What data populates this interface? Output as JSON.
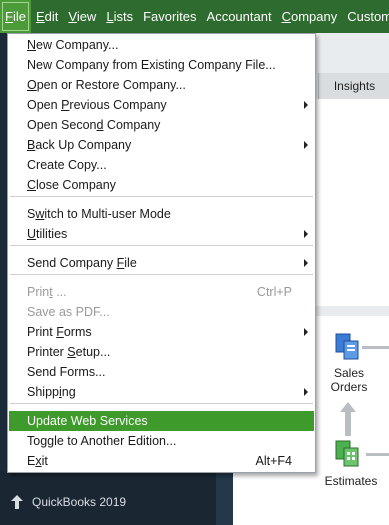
{
  "menubar": {
    "items": [
      {
        "label": "File",
        "underline": "F",
        "rest": "ile"
      },
      {
        "label": "Edit",
        "underline": "E",
        "rest": "dit"
      },
      {
        "label": "View",
        "underline": "V",
        "rest": "iew"
      },
      {
        "label": "Lists",
        "underline": "L",
        "rest": "ists"
      },
      {
        "label": "Favorites",
        "underline": "",
        "rest": "Favorites"
      },
      {
        "label": "Accountant",
        "underline": "",
        "rest": "Accountant"
      },
      {
        "label": "Company",
        "underline": "C",
        "rest": "ompany"
      },
      {
        "label": "Custom",
        "underline": "",
        "rest": "Custom"
      }
    ]
  },
  "file_menu": {
    "items": [
      {
        "label": "New Company...",
        "u": "N",
        "pre": "",
        "post": "ew Company...",
        "shortcut": "",
        "submenu": false,
        "disabled": false
      },
      {
        "label": "New Company from Existing Company File...",
        "u": "",
        "pre": "New Company from Existing Company File...",
        "post": "",
        "shortcut": "",
        "submenu": false,
        "disabled": false
      },
      {
        "label": "Open or Restore Company...",
        "u": "O",
        "pre": "",
        "post": "pen or Restore Company...",
        "shortcut": "",
        "submenu": false,
        "disabled": false
      },
      {
        "label": "Open Previous Company",
        "u": "P",
        "pre": "Open ",
        "post": "revious Company",
        "shortcut": "",
        "submenu": true,
        "disabled": false
      },
      {
        "label": "Open Second Company",
        "u": "d",
        "pre": "Open Secon",
        "post": " Company",
        "shortcut": "",
        "submenu": false,
        "disabled": false
      },
      {
        "label": "Back Up Company",
        "u": "B",
        "pre": "",
        "post": "ack Up Company",
        "shortcut": "",
        "submenu": true,
        "disabled": false
      },
      {
        "label": "Create Copy...",
        "u": "",
        "pre": "Create Copy...",
        "post": "",
        "shortcut": "",
        "submenu": false,
        "disabled": false
      },
      {
        "label": "Close Company",
        "u": "C",
        "pre": "",
        "post": "lose Company",
        "shortcut": "",
        "submenu": false,
        "disabled": false
      },
      {
        "label": "Switch to Multi-user Mode",
        "u": "w",
        "pre": "S",
        "post": "itch to Multi-user Mode",
        "shortcut": "",
        "submenu": false,
        "disabled": false
      },
      {
        "label": "Utilities",
        "u": "U",
        "pre": "",
        "post": "tilities",
        "shortcut": "",
        "submenu": true,
        "disabled": false
      },
      {
        "label": "Send Company File",
        "u": "F",
        "pre": "Send Company ",
        "post": "ile",
        "shortcut": "",
        "submenu": true,
        "disabled": false
      },
      {
        "label": "Print ...",
        "u": "t",
        "pre": "Prin",
        "post": " ...",
        "shortcut": "Ctrl+P",
        "submenu": false,
        "disabled": true
      },
      {
        "label": "Save as PDF...",
        "u": "",
        "pre": "Save as PDF...",
        "post": "",
        "shortcut": "",
        "submenu": false,
        "disabled": true
      },
      {
        "label": "Print Forms",
        "u": "F",
        "pre": "Print ",
        "post": "orms",
        "shortcut": "",
        "submenu": true,
        "disabled": false
      },
      {
        "label": "Printer Setup...",
        "u": "S",
        "pre": "Printer ",
        "post": "etup...",
        "shortcut": "",
        "submenu": false,
        "disabled": false
      },
      {
        "label": "Send Forms...",
        "u": "",
        "pre": "Send Forms...",
        "post": "",
        "shortcut": "",
        "submenu": false,
        "disabled": false
      },
      {
        "label": "Shipping",
        "u": "i",
        "pre": "Shipp",
        "post": "ng",
        "shortcut": "",
        "submenu": true,
        "disabled": false
      },
      {
        "label": "Update Web Services",
        "u": "",
        "pre": "Update Web Services",
        "post": "",
        "shortcut": "",
        "submenu": false,
        "disabled": false,
        "highlighted": true
      },
      {
        "label": "Toggle to Another Edition...",
        "u": "",
        "pre": "Toggle to Another Edition...",
        "post": "",
        "shortcut": "",
        "submenu": false,
        "disabled": false
      },
      {
        "label": "Exit",
        "u": "x",
        "pre": "E",
        "post": "it",
        "shortcut": "Alt+F4",
        "submenu": false,
        "disabled": false
      }
    ]
  },
  "main": {
    "tab_insights": "Insights",
    "flow": {
      "sales_orders_line1": "Sales",
      "sales_orders_line2": "Orders",
      "estimates": "Estimates"
    }
  },
  "sidebar": {
    "footer_label": "QuickBooks 2019"
  },
  "colors": {
    "menubar": "#2e6b2e",
    "highlight": "#3d9a2b",
    "sidebar": "#1c2b39"
  }
}
